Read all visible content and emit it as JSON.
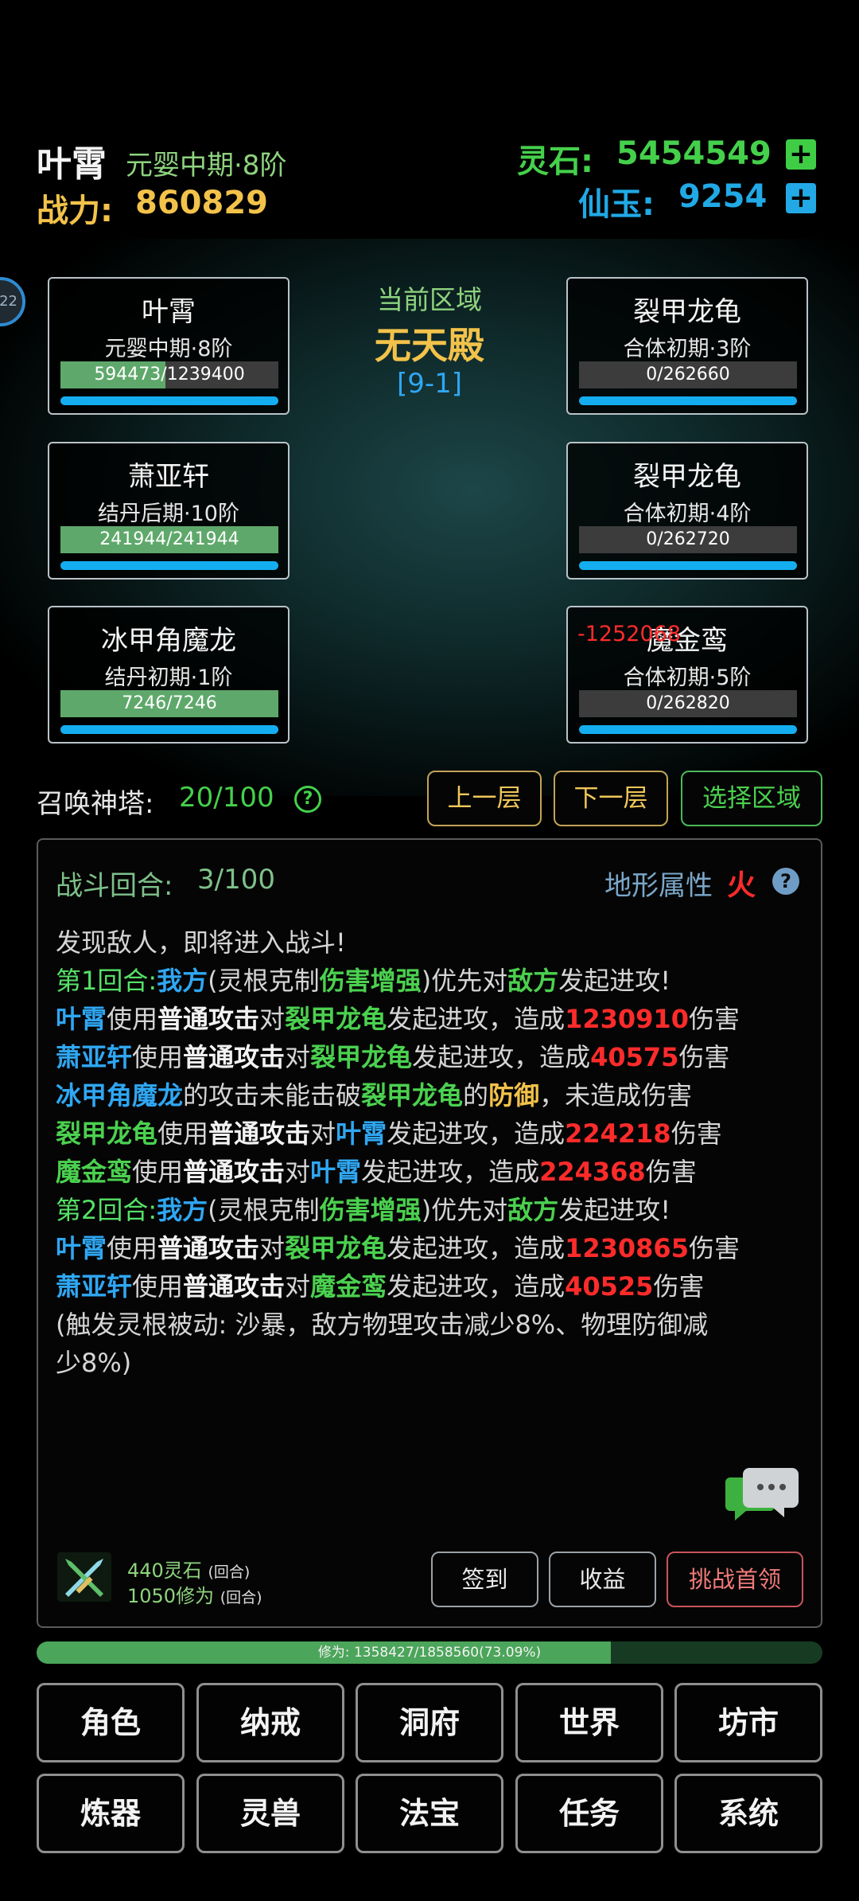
{
  "player": {
    "name": "叶霄",
    "realm": "元婴中期·8阶",
    "power_label": "战力:",
    "power_value": "860829"
  },
  "currency": {
    "spirit_stone_label": "灵石:",
    "spirit_stone_value": "5454549",
    "jade_label": "仙玉:",
    "jade_value": "9254"
  },
  "side_badge": "22",
  "zone": {
    "caption": "当前区域",
    "name": "无天殿",
    "stage": "[9-1]"
  },
  "allies": [
    {
      "name": "叶霄",
      "realm": "元婴中期·8阶",
      "hp": "594473/1239400",
      "hp_fraction": 0.48
    },
    {
      "name": "萧亚轩",
      "realm": "结丹后期·10阶",
      "hp": "241944/241944",
      "hp_fraction": 1.0
    },
    {
      "name": "冰甲角魔龙",
      "realm": "结丹初期·1阶",
      "hp": "7246/7246",
      "hp_fraction": 1.0
    }
  ],
  "enemies": [
    {
      "name": "裂甲龙龟",
      "realm": "合体初期·3阶",
      "hp": "0/262660",
      "hp_fraction": 0
    },
    {
      "name": "裂甲龙龟",
      "realm": "合体初期·4阶",
      "hp": "0/262720",
      "hp_fraction": 0
    },
    {
      "name": "魔金鸾",
      "realm": "合体初期·5阶",
      "hp": "0/262820",
      "hp_fraction": 0,
      "damage_popup": "-1252068"
    }
  ],
  "tower": {
    "label": "召唤神塔:",
    "value": "20/100",
    "help": "?",
    "prev_floor": "上一层",
    "next_floor": "下一层",
    "select_zone": "选择区域"
  },
  "battle": {
    "round_label": "战斗回合:",
    "round_value": "3/100",
    "terrain_label": "地形属性",
    "terrain_value": "火",
    "help": "?",
    "log": {
      "l1": "发现敌人，即将进入战斗!",
      "l2": {
        "a": "第1回合:",
        "b": "我方",
        "c": "(灵根克制",
        "d": "伤害增强",
        "e": ")优先对",
        "f": "敌方",
        "g": "发起进攻!"
      },
      "l3": {
        "a": "叶霄",
        "b": "使用",
        "c": "普通攻击",
        "d": "对",
        "e": "裂甲龙龟",
        "f": "发起进攻，造成",
        "g": "1230910",
        "h": "伤害"
      },
      "l4": {
        "a": "萧亚轩",
        "b": "使用",
        "c": "普通攻击",
        "d": "对",
        "e": "裂甲龙龟",
        "f": "发起进攻，造成",
        "g": "40575",
        "h": "伤害"
      },
      "l5": {
        "a": "冰甲角魔龙",
        "b": "的攻击未能击破",
        "c": "裂甲龙龟",
        "d": "的",
        "e": "防御",
        "f": "，未造成伤害"
      },
      "l6": {
        "a": "裂甲龙龟",
        "b": "使用",
        "c": "普通攻击",
        "d": "对",
        "e": "叶霄",
        "f": "发起进攻，造成",
        "g": "224218",
        "h": "伤害"
      },
      "l7": {
        "a": "魔金鸾",
        "b": "使用",
        "c": "普通攻击",
        "d": "对",
        "e": "叶霄",
        "f": "发起进攻，造成",
        "g": "224368",
        "h": "伤害"
      },
      "l8": {
        "a": "第2回合:",
        "b": "我方",
        "c": "(灵根克制",
        "d": "伤害增强",
        "e": ")优先对",
        "f": "敌方",
        "g": "发起进攻!"
      },
      "l9": {
        "a": "叶霄",
        "b": "使用",
        "c": "普通攻击",
        "d": "对",
        "e": "裂甲龙龟",
        "f": "发起进攻，造成",
        "g": "1230865",
        "h": "伤害"
      },
      "l10": {
        "a": "萧亚轩",
        "b": "使用",
        "c": "普通攻击",
        "d": "对",
        "e": "魔金鸾",
        "f": "发起进攻，造成",
        "g": "40525",
        "h": "伤害"
      },
      "l11": "(触发灵根被动: 沙暴，敌方物理攻击减少8%、物理防御减",
      "l12": "少8%)"
    },
    "reward1_amount": "440灵石",
    "reward1_unit": "(回合)",
    "reward2_amount": "1050修为",
    "reward2_unit": "(回合)",
    "checkin": "签到",
    "income": "收益",
    "challenge_boss": "挑战首领"
  },
  "cultivation": {
    "text": "修为: 1358427/1858560(73.09%)",
    "fraction": 0.7309
  },
  "nav": [
    "角色",
    "纳戒",
    "洞府",
    "世界",
    "坊市",
    "炼器",
    "灵兽",
    "法宝",
    "任务",
    "系统"
  ],
  "colors": {
    "green_accent": "#4bd14f",
    "blue_accent": "#2fa7f3",
    "gold_accent": "#f2c24a",
    "damage_red": "#ff2b2b"
  }
}
